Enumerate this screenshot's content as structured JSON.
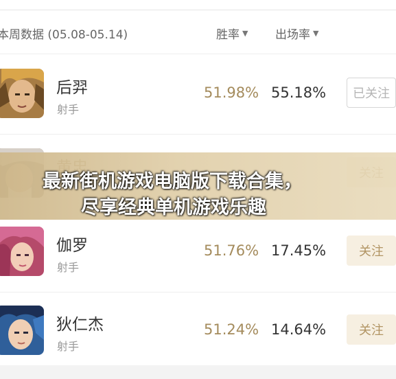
{
  "header": {
    "week_label": "本周数据 (05.08-05.14)",
    "win_rate_label": "胜率",
    "pick_rate_label": "出场率"
  },
  "heroes": [
    {
      "name": "后羿",
      "role": "射手",
      "win_rate": "51.98%",
      "pick_rate": "55.18%",
      "action": "已关注"
    },
    {
      "name": "黄忠",
      "role": "",
      "win_rate": "",
      "pick_rate": "",
      "action": "关注"
    },
    {
      "name": "伽罗",
      "role": "射手",
      "win_rate": "51.76%",
      "pick_rate": "17.45%",
      "action": "关注"
    },
    {
      "name": "狄仁杰",
      "role": "射手",
      "win_rate": "51.24%",
      "pick_rate": "14.64%",
      "action": "关注"
    }
  ],
  "banner": {
    "line1": "最新街机游戏电脑版下载合集，",
    "line2": "尽享经典单机游戏乐趣"
  },
  "colors": {
    "win_rate": "#a48b5c",
    "follow_bg": "#f6efe1",
    "follow_text": "#b19463",
    "banner_bg": "#d8c39a"
  },
  "icons": {
    "sort_indicator": "caret-down-icon"
  }
}
